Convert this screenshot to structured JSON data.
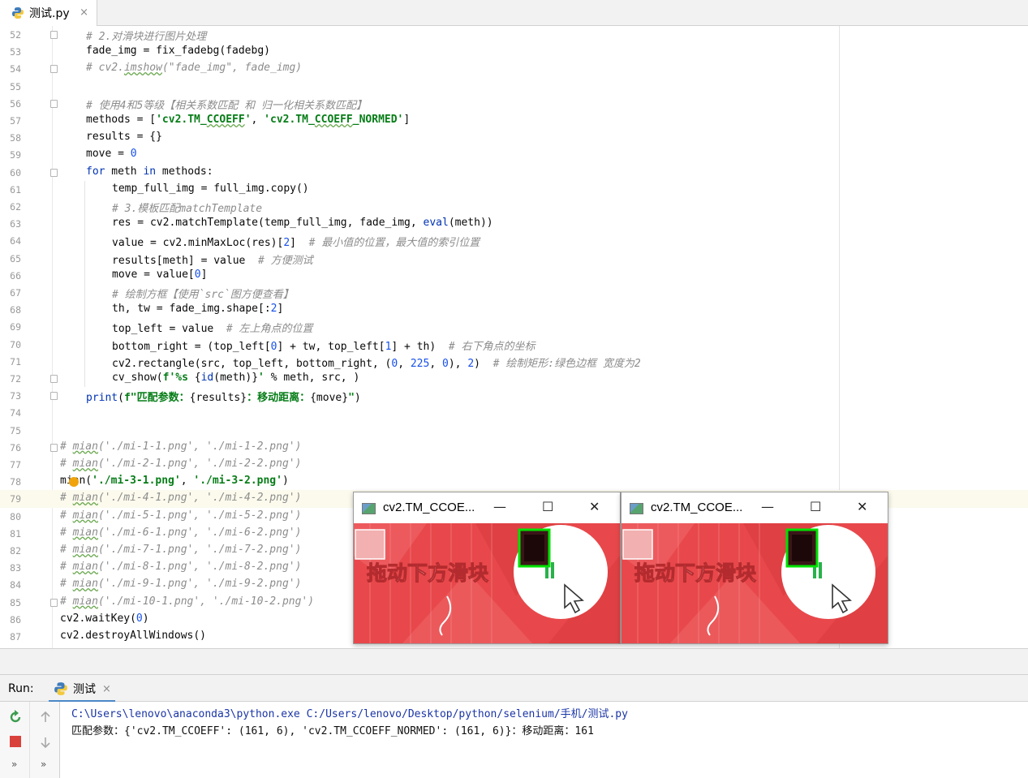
{
  "tab": {
    "file_name": "测试.py",
    "close": "×"
  },
  "editor": {
    "lines": [
      {
        "n": "52",
        "segs": [
          [
            "cmt",
            "# 2.对滑块进行图片处理"
          ]
        ],
        "indent": 1,
        "fold": true
      },
      {
        "n": "53",
        "segs": [
          [
            "",
            "fade_img = fix_fadebg(fadebg)"
          ]
        ],
        "indent": 1
      },
      {
        "n": "54",
        "segs": [
          [
            "cmt",
            "# cv2."
          ],
          [
            "cmt sq",
            "imshow"
          ],
          [
            "cmt",
            "(\"fade_img\", fade_img)"
          ]
        ],
        "indent": 1,
        "fold": true
      },
      {
        "n": "55",
        "segs": [],
        "indent": 1
      },
      {
        "n": "56",
        "segs": [
          [
            "cmt",
            "# 使用4和5等级【相关系数匹配 和 归一化相关系数匹配】"
          ]
        ],
        "indent": 1,
        "fold": true
      },
      {
        "n": "57",
        "segs": [
          [
            "",
            "methods = ["
          ],
          [
            "str",
            "'cv2.TM_"
          ],
          [
            "str sq",
            "CCOEFF"
          ],
          [
            "str",
            "'"
          ],
          [
            "",
            ", "
          ],
          [
            "str",
            "'cv2.TM_"
          ],
          [
            "str sq",
            "CCOEFF"
          ],
          [
            "str",
            "_NORMED'"
          ],
          [
            "",
            "]"
          ]
        ],
        "indent": 1
      },
      {
        "n": "58",
        "segs": [
          [
            "",
            "results = {}"
          ]
        ],
        "indent": 1
      },
      {
        "n": "59",
        "segs": [
          [
            "",
            "move = "
          ],
          [
            "num",
            "0"
          ]
        ],
        "indent": 1
      },
      {
        "n": "60",
        "segs": [
          [
            "kw",
            "for"
          ],
          [
            "",
            " meth "
          ],
          [
            "kw",
            "in"
          ],
          [
            "",
            " methods:"
          ]
        ],
        "indent": 1,
        "fold": true
      },
      {
        "n": "61",
        "segs": [
          [
            "",
            "temp_full_img = full_img.copy()"
          ]
        ],
        "indent": 2
      },
      {
        "n": "62",
        "segs": [
          [
            "cmt",
            "# 3.模板匹配matchTemplate"
          ]
        ],
        "indent": 2
      },
      {
        "n": "63",
        "segs": [
          [
            "",
            "res = cv2.matchTemplate(temp_full_img, fade_img, "
          ],
          [
            "fx",
            "eval"
          ],
          [
            "",
            "(meth))"
          ]
        ],
        "indent": 2
      },
      {
        "n": "64",
        "segs": [
          [
            "",
            "value = cv2.minMaxLoc(res)["
          ],
          [
            "num",
            "2"
          ],
          [
            "",
            "]  "
          ],
          [
            "cmt",
            "# 最小值的位置，最大值的索引位置"
          ]
        ],
        "indent": 2
      },
      {
        "n": "65",
        "segs": [
          [
            "",
            "results[meth] = value  "
          ],
          [
            "cmt",
            "# 方便测试"
          ]
        ],
        "indent": 2
      },
      {
        "n": "66",
        "segs": [
          [
            "",
            "move = value["
          ],
          [
            "num",
            "0"
          ],
          [
            "",
            "]"
          ]
        ],
        "indent": 2
      },
      {
        "n": "67",
        "segs": [
          [
            "cmt",
            "# 绘制方框【使用`src`图方便查看】"
          ]
        ],
        "indent": 2
      },
      {
        "n": "68",
        "segs": [
          [
            "",
            "th, tw = fade_img.shape[:"
          ],
          [
            "num",
            "2"
          ],
          [
            "",
            "]"
          ]
        ],
        "indent": 2
      },
      {
        "n": "69",
        "segs": [
          [
            "",
            "top_left = value  "
          ],
          [
            "cmt",
            "# 左上角点的位置"
          ]
        ],
        "indent": 2
      },
      {
        "n": "70",
        "segs": [
          [
            "",
            "bottom_right = (top_left["
          ],
          [
            "num",
            "0"
          ],
          [
            "",
            "] + tw, top_left["
          ],
          [
            "num",
            "1"
          ],
          [
            "",
            "] + th)  "
          ],
          [
            "cmt",
            "# 右下角点的坐标"
          ]
        ],
        "indent": 2
      },
      {
        "n": "71",
        "segs": [
          [
            "",
            "cv2.rectangle(src, top_left, bottom_right, ("
          ],
          [
            "num",
            "0"
          ],
          [
            "",
            ", "
          ],
          [
            "num",
            "225"
          ],
          [
            "",
            ", "
          ],
          [
            "num",
            "0"
          ],
          [
            "",
            "), "
          ],
          [
            "num",
            "2"
          ],
          [
            "",
            ")  "
          ],
          [
            "cmt",
            "# 绘制矩形:绿色边框 宽度为2"
          ]
        ],
        "indent": 2
      },
      {
        "n": "72",
        "segs": [
          [
            "",
            "cv_show("
          ],
          [
            "str",
            "f'%s "
          ],
          [
            "",
            "{"
          ],
          [
            "fx",
            "id"
          ],
          [
            "",
            "(meth)}"
          ],
          [
            "str",
            "'"
          ],
          [
            "",
            " % meth, src, )"
          ]
        ],
        "indent": 2,
        "fold": true
      },
      {
        "n": "73",
        "segs": [
          [
            "fx",
            "print"
          ],
          [
            "",
            "("
          ],
          [
            "str",
            "f\"匹配参数："
          ],
          [
            "",
            "{results}"
          ],
          [
            "str",
            "：移动距离："
          ],
          [
            "",
            "{move}"
          ],
          [
            "str",
            "\""
          ],
          [
            "",
            ")"
          ]
        ],
        "indent": 1,
        "fold": true
      },
      {
        "n": "74",
        "segs": [],
        "indent": 0
      },
      {
        "n": "75",
        "segs": [],
        "indent": 0
      },
      {
        "n": "76",
        "segs": [
          [
            "cmt",
            "# "
          ],
          [
            "cmt sq",
            "mian"
          ],
          [
            "cmt",
            "('./mi-1-1.png', './mi-1-2.png')"
          ]
        ],
        "indent": 0,
        "fold": true
      },
      {
        "n": "77",
        "segs": [
          [
            "cmt",
            "# "
          ],
          [
            "cmt sq",
            "mian"
          ],
          [
            "cmt",
            "('./mi-2-1.png', './mi-2-2.png')"
          ]
        ],
        "indent": 0
      },
      {
        "n": "78",
        "segs": [
          [
            "",
            "mian("
          ],
          [
            "str",
            "'./mi-3-1.png'"
          ],
          [
            "",
            ", "
          ],
          [
            "str",
            "'./mi-3-2.png'"
          ],
          [
            "",
            ")"
          ]
        ],
        "indent": 0
      },
      {
        "n": "79",
        "segs": [
          [
            "cmt",
            "# "
          ],
          [
            "cmt sq",
            "mian"
          ],
          [
            "cmt",
            "('./mi-4-1.png', './mi-4-2.png')"
          ]
        ],
        "indent": 0,
        "hl": true
      },
      {
        "n": "80",
        "segs": [
          [
            "cmt",
            "# "
          ],
          [
            "cmt sq",
            "mian"
          ],
          [
            "cmt",
            "('./mi-5-1.png', './mi-5-2.png')"
          ]
        ],
        "indent": 0
      },
      {
        "n": "81",
        "segs": [
          [
            "cmt",
            "# "
          ],
          [
            "cmt sq",
            "mian"
          ],
          [
            "cmt",
            "('./mi-6-1.png', './mi-6-2.png')"
          ]
        ],
        "indent": 0
      },
      {
        "n": "82",
        "segs": [
          [
            "cmt",
            "# "
          ],
          [
            "cmt sq",
            "mian"
          ],
          [
            "cmt",
            "('./mi-7-1.png', './mi-7-2.png')"
          ]
        ],
        "indent": 0
      },
      {
        "n": "83",
        "segs": [
          [
            "cmt",
            "# "
          ],
          [
            "cmt sq",
            "mian"
          ],
          [
            "cmt",
            "('./mi-8-1.png', './mi-8-2.png')"
          ]
        ],
        "indent": 0
      },
      {
        "n": "84",
        "segs": [
          [
            "cmt",
            "# "
          ],
          [
            "cmt sq",
            "mian"
          ],
          [
            "cmt",
            "('./mi-9-1.png', './mi-9-2.png')"
          ]
        ],
        "indent": 0
      },
      {
        "n": "85",
        "segs": [
          [
            "cmt",
            "# "
          ],
          [
            "cmt sq",
            "mian"
          ],
          [
            "cmt",
            "('./mi-10-1.png', './mi-10-2.png')"
          ]
        ],
        "indent": 0,
        "fold": true
      },
      {
        "n": "86",
        "segs": [
          [
            "",
            "cv2.waitKey("
          ],
          [
            "num",
            "0"
          ],
          [
            "",
            ")"
          ]
        ],
        "indent": 0
      },
      {
        "n": "87",
        "segs": [
          [
            "",
            "cv2.destroyAllWindows()"
          ]
        ],
        "indent": 0
      }
    ]
  },
  "image_windows": [
    {
      "title": "cv2.TM_CCOE...",
      "caption": "拖动下方滑块",
      "minimize": "—",
      "maximize": "☐",
      "close": "✕"
    },
    {
      "title": "cv2.TM_CCOE...",
      "caption": "拖动下方滑块",
      "minimize": "—",
      "maximize": "☐",
      "close": "✕"
    }
  ],
  "run_panel": {
    "label": "Run:",
    "tab_label": "测试",
    "tab_close": "×",
    "command": "C:\\Users\\lenovo\\anaconda3\\python.exe C:/Users/lenovo/Desktop/python/selenium/手机/测试.py",
    "output": "匹配参数：{'cv2.TM_CCOEFF': (161, 6), 'cv2.TM_CCOEFF_NORMED': (161, 6)}：移动距离：161"
  },
  "colors": {
    "keyword": "#0033b3",
    "string": "#067d17",
    "number": "#1750eb",
    "comment": "#8c8c8c",
    "captcha_bg": "#e8484b",
    "match_box": "#00e100"
  }
}
